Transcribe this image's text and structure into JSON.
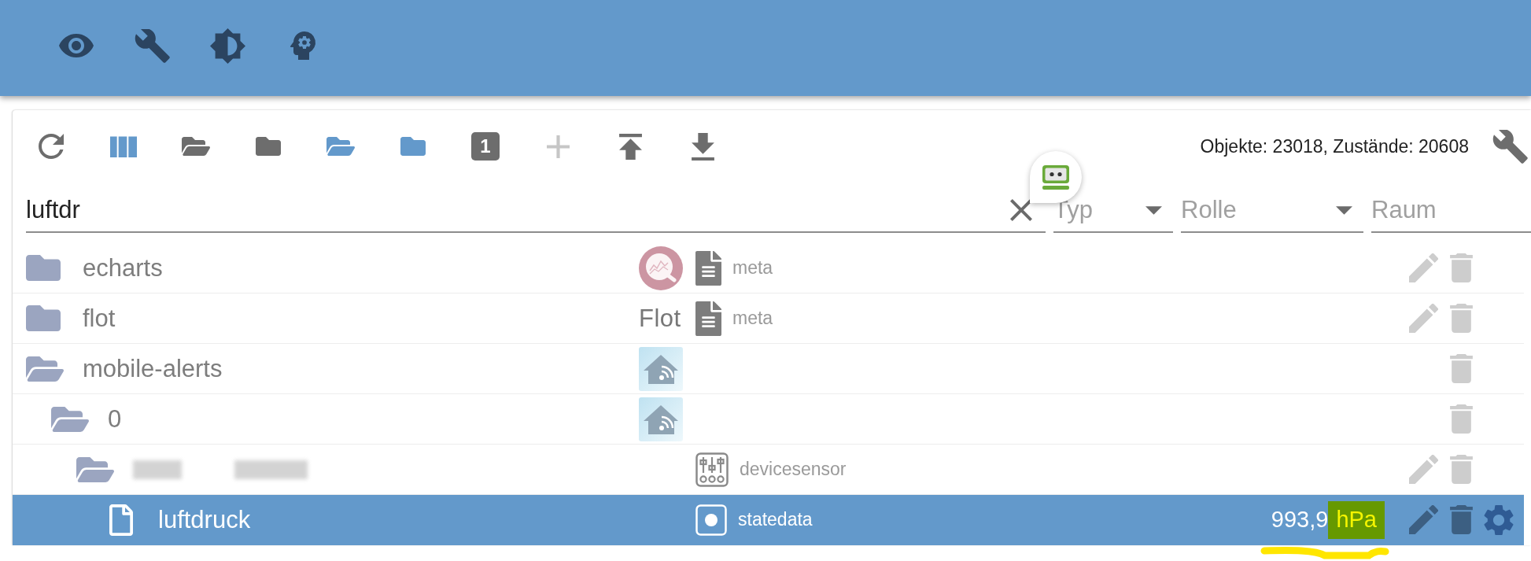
{
  "toolbar": {
    "buttons": [
      {
        "kind": "refresh",
        "accent": false,
        "disabled": false
      },
      {
        "kind": "columns",
        "accent": true,
        "disabled": false
      },
      {
        "kind": "folder-open",
        "accent": false,
        "disabled": false
      },
      {
        "kind": "folder",
        "accent": false,
        "disabled": false
      },
      {
        "kind": "folder-open",
        "accent": true,
        "disabled": false
      },
      {
        "kind": "folder",
        "accent": true,
        "disabled": false
      },
      {
        "kind": "number",
        "label": "1",
        "accent": false,
        "disabled": false
      },
      {
        "kind": "add",
        "accent": false,
        "disabled": true
      },
      {
        "kind": "upload",
        "accent": false,
        "disabled": false
      },
      {
        "kind": "download",
        "accent": false,
        "disabled": false
      }
    ],
    "counts": "Objekte: 23018, Zustände: 20608"
  },
  "search": {
    "value": "luftdr"
  },
  "filters": [
    {
      "kind": "select",
      "placeholder": "Typ"
    },
    {
      "kind": "select",
      "placeholder": "Rolle"
    },
    {
      "kind": "text",
      "placeholder": "Raum"
    }
  ],
  "tree": [
    {
      "name": "echarts",
      "kind": "folder",
      "expanded": false,
      "selected": false,
      "redacted": false,
      "logo": {
        "kind": "chart-circle"
      },
      "type": {
        "kind": "document",
        "label": "meta"
      },
      "editable": true,
      "configurable": false
    },
    {
      "name": "flot",
      "kind": "folder",
      "expanded": false,
      "selected": false,
      "redacted": false,
      "logo": {
        "kind": "wordmark",
        "text": "Flot"
      },
      "type": {
        "kind": "document",
        "label": "meta"
      },
      "editable": true,
      "configurable": false
    },
    {
      "name": "mobile-alerts",
      "kind": "folder",
      "expanded": true,
      "selected": false,
      "redacted": false,
      "logo": {
        "kind": "house-signal"
      },
      "editable": false,
      "configurable": false,
      "children": [
        {
          "name": "0",
          "kind": "folder",
          "expanded": true,
          "selected": false,
          "redacted": false,
          "logo": {
            "kind": "house-signal"
          },
          "editable": false,
          "configurable": false,
          "children": [
            {
              "kind": "folder",
              "expanded": true,
              "selected": false,
              "redacted": true,
              "type": {
                "kind": "sliders",
                "label": "devicesensor"
              },
              "editable": true,
              "configurable": false,
              "children": [
                {
                  "name": "luftdruck",
                  "kind": "state",
                  "selected": true,
                  "redacted": false,
                  "type": {
                    "kind": "state",
                    "label": "statedata"
                  },
                  "reading": {
                    "value": "993,9",
                    "unit": "hPa",
                    "underlined": true
                  },
                  "editable": true,
                  "configurable": true
                }
              ]
            }
          ]
        }
      ]
    }
  ]
}
